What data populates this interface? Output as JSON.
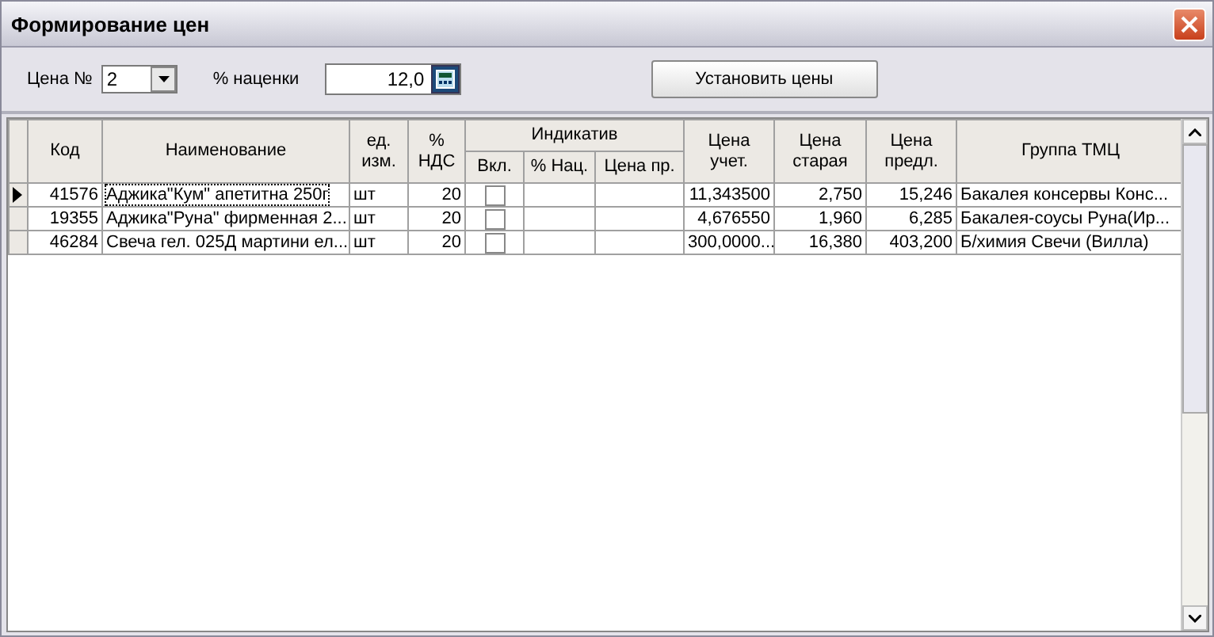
{
  "window": {
    "title": "Формирование цен"
  },
  "toolbar": {
    "price_label": "Цена №",
    "price_number": "2",
    "markup_label": "% наценки",
    "markup_value": "12,0",
    "apply_button": "Установить цены"
  },
  "table": {
    "columns": [
      {
        "label": "Код"
      },
      {
        "label": "Наименование"
      },
      {
        "label": "ед.\nизм."
      },
      {
        "label": "%\nНДС"
      },
      {
        "group": "Индикатив",
        "children": [
          "Вкл.",
          "% Нац.",
          "Цена пр."
        ]
      },
      {
        "label": "Цена\nучет."
      },
      {
        "label": "Цена\nстарая"
      },
      {
        "label": "Цена\nпредл."
      },
      {
        "label": "Группа ТМЦ"
      }
    ],
    "rows": [
      {
        "selected": true,
        "code": "41576",
        "name": "Аджика\"Кум\" апетитна 250г",
        "unit": "шт",
        "vat": "20",
        "checked": false,
        "cost_price": "11,343500",
        "old_price": "2,750",
        "proposed_price": "15,246",
        "group": "Бакалея консервы Конс..."
      },
      {
        "selected": false,
        "code": "19355",
        "name": "Аджика\"Руна\" фирменная 2...",
        "unit": "шт",
        "vat": "20",
        "checked": false,
        "cost_price": "4,676550",
        "old_price": "1,960",
        "proposed_price": "6,285",
        "group": "Бакалея-соусы Руна(Ир..."
      },
      {
        "selected": false,
        "code": "46284",
        "name": "Свеча гел. 025Д мартини ел...",
        "unit": "шт",
        "vat": "20",
        "checked": false,
        "cost_price": "300,0000...",
        "old_price": "16,380",
        "proposed_price": "403,200",
        "group": "Б/химия Свечи (Вилла)"
      }
    ]
  }
}
